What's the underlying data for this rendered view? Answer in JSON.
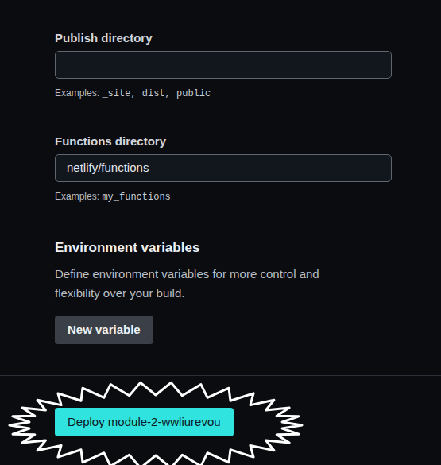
{
  "fields": [
    {
      "label": "Publish directory",
      "value": "",
      "examples_label": "Examples:",
      "examples": "_site, dist, public"
    },
    {
      "label": "Functions directory",
      "value": "netlify/functions",
      "examples_label": "Examples:",
      "examples": "my_functions"
    }
  ],
  "environment": {
    "title": "Environment variables",
    "description": "Define environment variables for more control and flexibility over your build.",
    "button": "New variable"
  },
  "deploy_button": "Deploy module-2-wwliurevou"
}
